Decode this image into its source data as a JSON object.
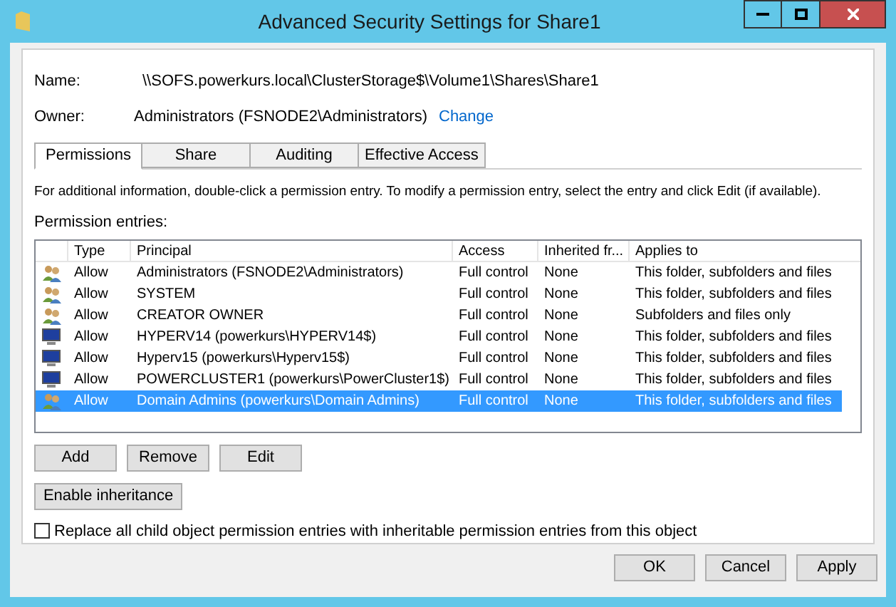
{
  "window": {
    "title": "Advanced Security Settings for Share1"
  },
  "name": {
    "label": "Name:",
    "value": "\\\\SOFS.powerkurs.local\\ClusterStorage$\\Volume1\\Shares\\Share1"
  },
  "owner": {
    "label": "Owner:",
    "value": "Administrators (FSNODE2\\Administrators)",
    "link": "Change"
  },
  "tabs": [
    {
      "label": "Permissions",
      "selected": true
    },
    {
      "label": "Share",
      "selected": false
    },
    {
      "label": "Auditing",
      "selected": false
    },
    {
      "label": "Effective Access",
      "selected": false
    }
  ],
  "info": "For additional information, double-click a permission entry. To modify a permission entry, select the entry and click Edit (if available).",
  "entries_label": "Permission entries:",
  "table": {
    "columns": [
      "Type",
      "Principal",
      "Access",
      "Inherited fr...",
      "Applies to"
    ],
    "rows": [
      {
        "kind": "group",
        "type": "Allow",
        "principal": "Administrators (FSNODE2\\Administrators)",
        "access": "Full control",
        "inherited": "None",
        "applies": "This folder, subfolders and files",
        "selected": false
      },
      {
        "kind": "group",
        "type": "Allow",
        "principal": "SYSTEM",
        "access": "Full control",
        "inherited": "None",
        "applies": "This folder, subfolders and files",
        "selected": false
      },
      {
        "kind": "group",
        "type": "Allow",
        "principal": "CREATOR OWNER",
        "access": "Full control",
        "inherited": "None",
        "applies": "Subfolders and files only",
        "selected": false
      },
      {
        "kind": "computer",
        "type": "Allow",
        "principal": "HYPERV14 (powerkurs\\HYPERV14$)",
        "access": "Full control",
        "inherited": "None",
        "applies": "This folder, subfolders and files",
        "selected": false
      },
      {
        "kind": "computer",
        "type": "Allow",
        "principal": "Hyperv15 (powerkurs\\Hyperv15$)",
        "access": "Full control",
        "inherited": "None",
        "applies": "This folder, subfolders and files",
        "selected": false
      },
      {
        "kind": "computer",
        "type": "Allow",
        "principal": "POWERCLUSTER1 (powerkurs\\PowerCluster1$)",
        "access": "Full control",
        "inherited": "None",
        "applies": "This folder, subfolders and files",
        "selected": false
      },
      {
        "kind": "group",
        "type": "Allow",
        "principal": "Domain Admins (powerkurs\\Domain Admins)",
        "access": "Full control",
        "inherited": "None",
        "applies": "This folder, subfolders and files",
        "selected": true
      }
    ]
  },
  "entry_buttons": [
    "Add",
    "Remove",
    "Edit"
  ],
  "inheritance_button": "Enable inheritance",
  "replace": {
    "label": "Replace all child object permission entries with inheritable permission entries from this object",
    "checked": false
  },
  "dialog_buttons": [
    "OK",
    "Cancel",
    "Apply"
  ]
}
